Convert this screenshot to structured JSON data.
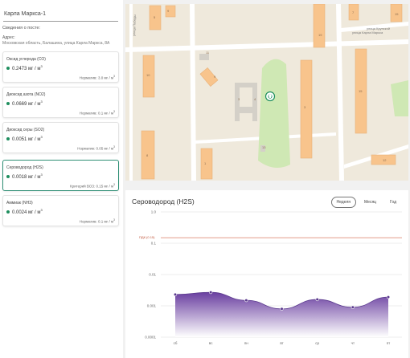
{
  "post": {
    "selected": "Карла Маркса-1",
    "caption": "Сведения о посте:",
    "address_label": "Адрес:",
    "address_value": "Московская область, Балашиха, улица Карла Маркса, 8А"
  },
  "pollutants": [
    {
      "name": "Оксид углерода (СО)",
      "value": "0.2473 мг / м",
      "sup": "3",
      "norm": "Норматив: 3.0 мг / м",
      "norm_sup": "3",
      "active": false
    },
    {
      "name": "Диоксид азота (NO2)",
      "value": "0.0669 мг / м",
      "sup": "3",
      "norm": "Норматив: 0.1 мг / м",
      "norm_sup": "3",
      "active": false
    },
    {
      "name": "Диоксид серы (SO2)",
      "value": "0.0051 мг / м",
      "sup": "3",
      "norm": "Норматив: 0.05 мг / м",
      "norm_sup": "3",
      "active": false
    },
    {
      "name": "Сероводород (H2S)",
      "value": "0.0018 мг / м",
      "sup": "3",
      "norm": "Критерий ВОЗ: 0.15 мг / м",
      "norm_sup": "3",
      "active": true
    },
    {
      "name": "Аммиак (NH3)",
      "value": "0.0024 мг / м",
      "sup": "3",
      "norm": "Норматив: 0.1 мг / м",
      "norm_sup": "3",
      "active": false
    }
  ],
  "map": {
    "street_labels": [
      "улица Карла Маркса",
      "улица Крупской",
      "улица Победы"
    ],
    "building_numbers": [
      "5",
      "19",
      "7",
      "15",
      "10",
      "8",
      "3",
      "15",
      "11",
      "13",
      "9",
      "12",
      "1",
      "9",
      "4",
      "3"
    ],
    "colors": {
      "background": "#efe9dc",
      "building": "#f8c48c",
      "park": "#cfe8b4",
      "road": "#ffffff",
      "marker": "#1e8e5e"
    }
  },
  "chart": {
    "title": "Сероводород (H2S)",
    "periods": [
      {
        "label": "Неделя",
        "active": true
      },
      {
        "label": "Месяц",
        "active": false
      },
      {
        "label": "Год",
        "active": false
      }
    ],
    "pdk_label": "ПДК (0.15)"
  },
  "chart_data": {
    "type": "area",
    "yscale": "log",
    "yticks": [
      "1.0",
      "0.1",
      "0.01",
      "0.001",
      "0.0001"
    ],
    "ylim": [
      0.0001,
      1.0
    ],
    "categories": [
      "сб",
      "вс",
      "пн",
      "вт",
      "ср",
      "чт",
      "пт"
    ],
    "values": [
      0.0023,
      0.0027,
      0.0015,
      0.0008,
      0.0016,
      0.0009,
      0.0019
    ],
    "threshold": 0.15,
    "colors": {
      "fill_top": "#6a3fa0",
      "fill_bottom": "#ffffff",
      "point": "#5b3a8e",
      "threshold": "#d97b62",
      "grid": "#dddddd"
    }
  }
}
